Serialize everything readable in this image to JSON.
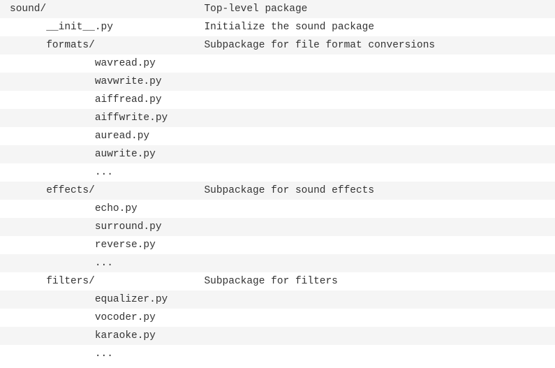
{
  "lines": [
    {
      "text": "sound/                          Top-level package"
    },
    {
      "text": "      __init__.py               Initialize the sound package"
    },
    {
      "text": "      formats/                  Subpackage for file format conversions"
    },
    {
      "text": "              wavread.py"
    },
    {
      "text": "              wavwrite.py"
    },
    {
      "text": "              aiffread.py"
    },
    {
      "text": "              aiffwrite.py"
    },
    {
      "text": "              auread.py"
    },
    {
      "text": "              auwrite.py"
    },
    {
      "text": "              ..."
    },
    {
      "text": "      effects/                  Subpackage for sound effects"
    },
    {
      "text": "              echo.py"
    },
    {
      "text": "              surround.py"
    },
    {
      "text": "              reverse.py"
    },
    {
      "text": "              ..."
    },
    {
      "text": "      filters/                  Subpackage for filters"
    },
    {
      "text": "              equalizer.py"
    },
    {
      "text": "              vocoder.py"
    },
    {
      "text": "              karaoke.py"
    },
    {
      "text": "              ..."
    }
  ]
}
